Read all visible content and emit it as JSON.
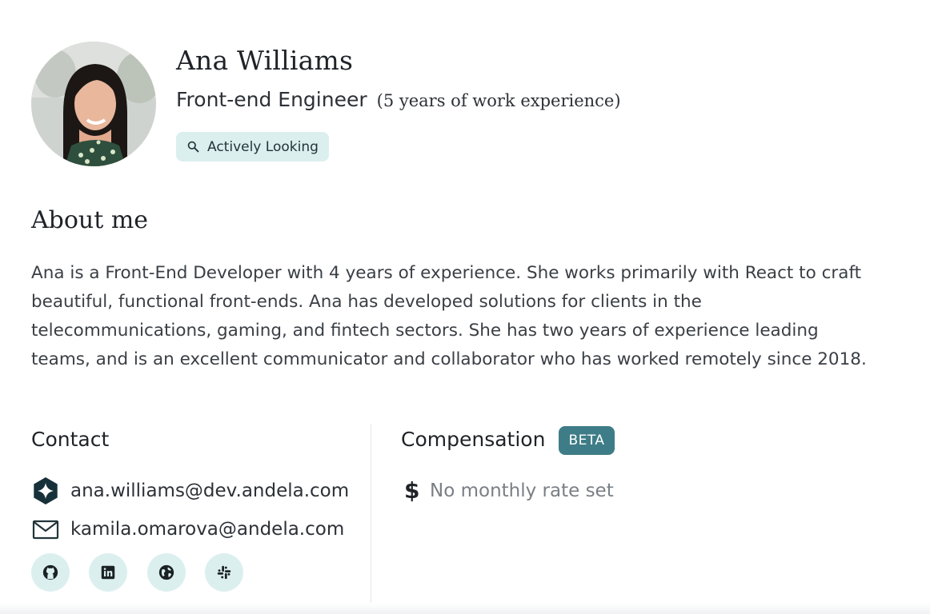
{
  "profile": {
    "name": "Ana Williams",
    "role": "Front-end Engineer",
    "experience": "(5 years of work experience)",
    "status": "Actively Looking",
    "avatar_icon": "profile-photo"
  },
  "about": {
    "title": "About me",
    "text": "Ana is a Front-End Developer with 4 years of experience. She works primarily with React to craft beautiful, functional front-ends. Ana has developed solutions for clients in the telecommunications, gaming, and fintech sectors. She has two years of experience leading teams, and is an excellent communicator and collaborator who has worked remotely since 2018."
  },
  "contact": {
    "title": "Contact",
    "items": [
      {
        "icon": "andela-logo-icon",
        "value": "ana.williams@dev.andela.com"
      },
      {
        "icon": "mail-icon",
        "value": "kamila.omarova@andela.com"
      }
    ],
    "socials": [
      {
        "icon": "github-icon"
      },
      {
        "icon": "linkedin-icon"
      },
      {
        "icon": "globe-icon"
      },
      {
        "icon": "slack-icon"
      }
    ]
  },
  "compensation": {
    "title": "Compensation",
    "badge": "BETA",
    "currency_symbol": "$",
    "rate": "No monthly rate set"
  },
  "colors": {
    "accent": "#3e7d87",
    "badge_bg": "#dcefef",
    "text": "#1f2328",
    "muted": "#7a7f85"
  }
}
